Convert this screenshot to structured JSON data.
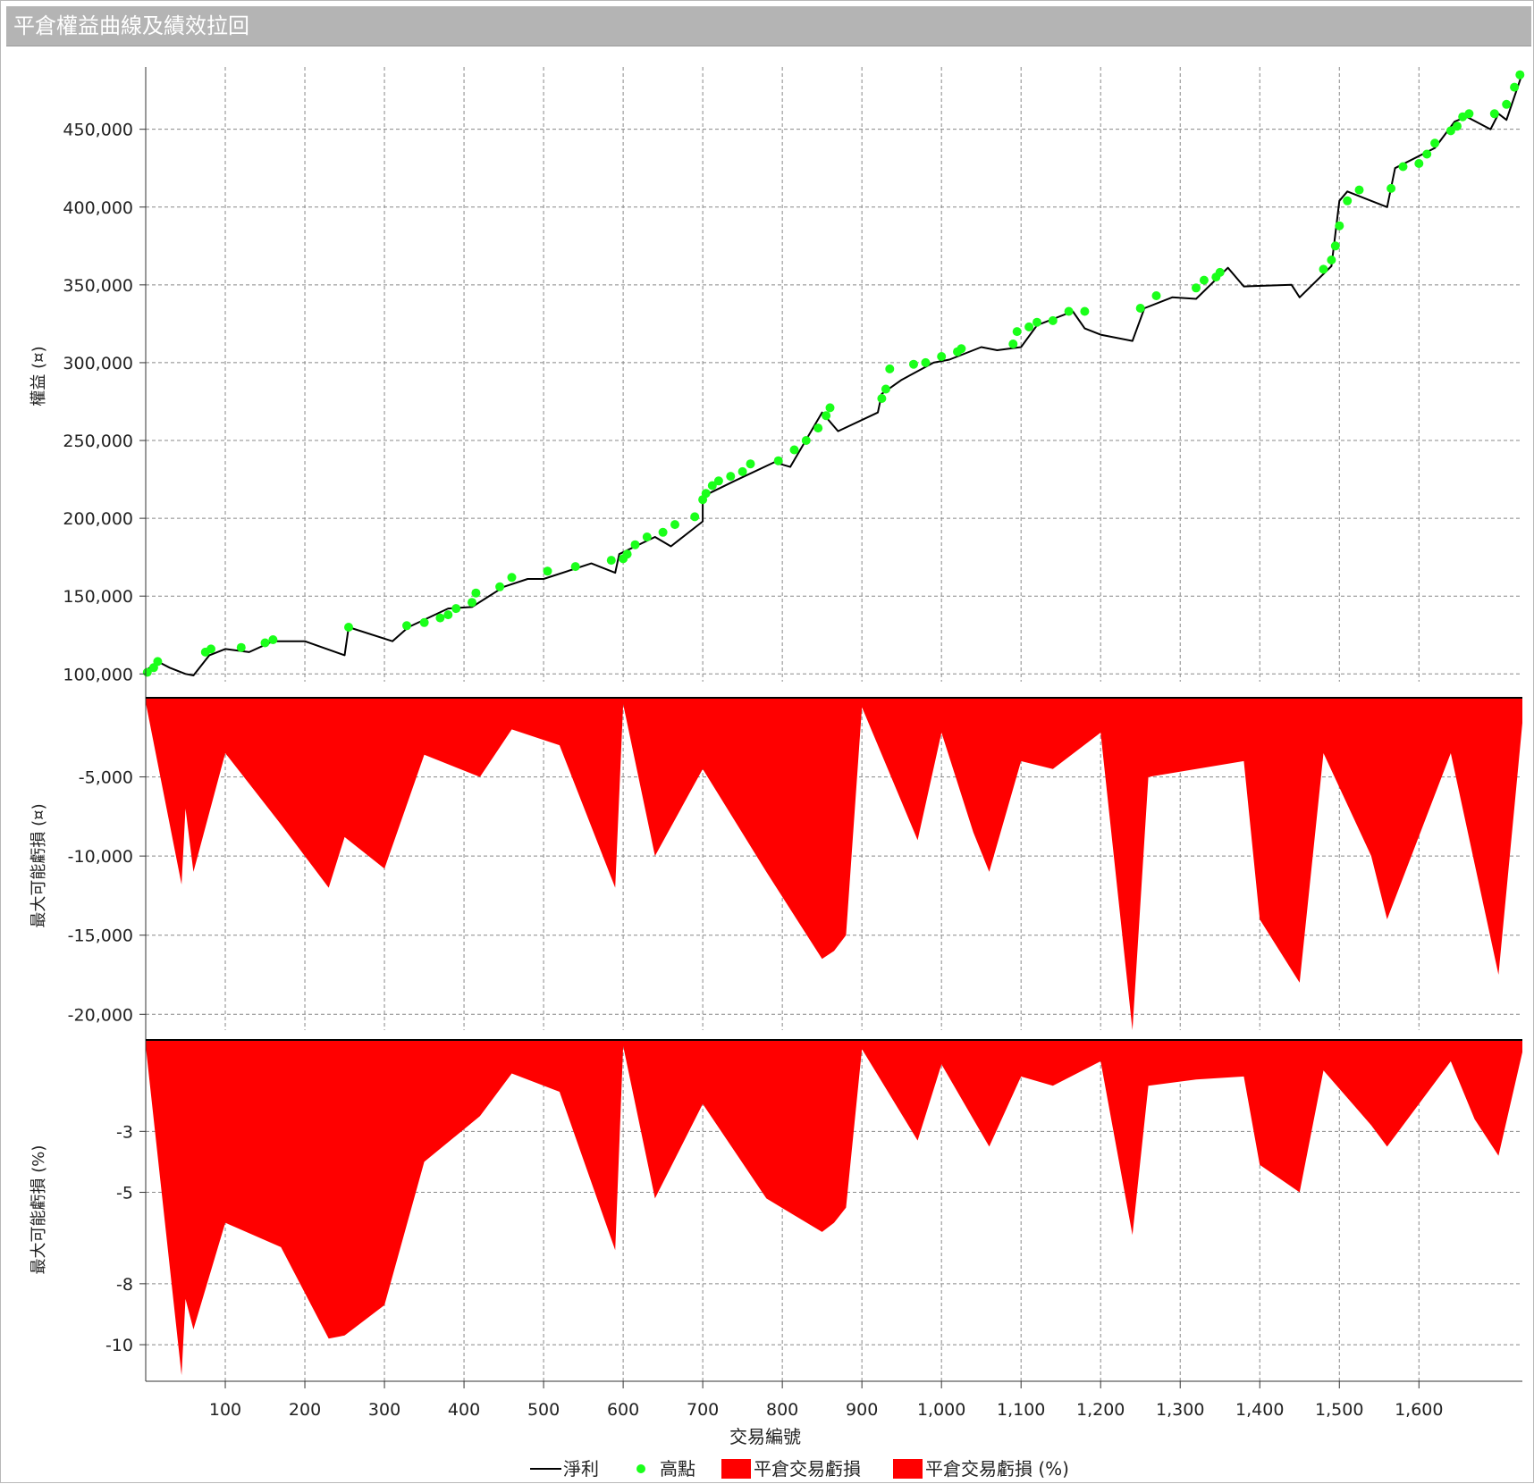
{
  "window": {
    "title": "平倉權益曲線及績效拉回"
  },
  "colors": {
    "line": "#000000",
    "high": "#1aff1a",
    "loss": "#ff0000",
    "grid": "#888888"
  },
  "legend": [
    {
      "label": "淨利",
      "kind": "line"
    },
    {
      "label": "高點",
      "kind": "dot"
    },
    {
      "label": "平倉交易虧損",
      "kind": "area"
    },
    {
      "label": "平倉交易虧損 (%)",
      "kind": "area"
    }
  ],
  "x_axis": {
    "label": "交易編號",
    "range": [
      0,
      1730
    ],
    "ticks": [
      100,
      200,
      300,
      400,
      500,
      600,
      700,
      800,
      900,
      1000,
      1100,
      1200,
      1300,
      1400,
      1500,
      1600
    ],
    "tick_labels": [
      "100",
      "200",
      "300",
      "400",
      "500",
      "600",
      "700",
      "800",
      "900",
      "1,000",
      "1,100",
      "1,200",
      "1,300",
      "1,400",
      "1,500",
      "1,600"
    ]
  },
  "chart_data": [
    {
      "type": "line",
      "ylabel": "權益 (¤)",
      "ylim": [
        95000,
        490000
      ],
      "yticks": [
        100000,
        150000,
        200000,
        250000,
        300000,
        350000,
        400000,
        450000
      ],
      "ytick_labels": [
        "100,000",
        "150,000",
        "200,000",
        "250,000",
        "300,000",
        "350,000",
        "400,000",
        "450,000"
      ],
      "grid": true,
      "series": [
        {
          "name": "淨利",
          "x": [
            0,
            15,
            30,
            50,
            60,
            80,
            100,
            130,
            160,
            200,
            250,
            255,
            310,
            330,
            380,
            410,
            450,
            480,
            500,
            560,
            590,
            595,
            640,
            660,
            700,
            700,
            740,
            790,
            810,
            850,
            870,
            920,
            925,
            950,
            990,
            1010,
            1050,
            1070,
            1100,
            1120,
            1165,
            1180,
            1200,
            1240,
            1255,
            1290,
            1320,
            1360,
            1380,
            1440,
            1450,
            1490,
            1500,
            1510,
            1560,
            1570,
            1620,
            1645,
            1660,
            1690,
            1700,
            1710,
            1730
          ],
          "y": [
            102000,
            108000,
            104000,
            100000,
            99000,
            112000,
            116000,
            114000,
            121000,
            121000,
            112000,
            130000,
            121000,
            130000,
            142000,
            143000,
            156000,
            161000,
            161000,
            171000,
            165000,
            177000,
            188000,
            182000,
            198000,
            214000,
            224000,
            236000,
            233000,
            268000,
            256000,
            268000,
            280000,
            289000,
            300000,
            302000,
            310000,
            308000,
            310000,
            324000,
            333000,
            322000,
            318000,
            314000,
            335000,
            342000,
            341000,
            361000,
            349000,
            350000,
            342000,
            362000,
            404000,
            410000,
            400000,
            425000,
            438000,
            455000,
            458000,
            450000,
            460000,
            456000,
            486000
          ]
        },
        {
          "name": "高點",
          "x": [
            2,
            10,
            15,
            75,
            82,
            120,
            150,
            160,
            255,
            328,
            350,
            370,
            380,
            390,
            410,
            415,
            445,
            460,
            505,
            540,
            585,
            600,
            605,
            615,
            630,
            650,
            665,
            690,
            700,
            704,
            712,
            720,
            735,
            750,
            760,
            795,
            815,
            830,
            845,
            855,
            860,
            925,
            930,
            935,
            965,
            980,
            1000,
            1020,
            1025,
            1090,
            1095,
            1110,
            1120,
            1140,
            1160,
            1180,
            1250,
            1270,
            1320,
            1330,
            1345,
            1350,
            1480,
            1490,
            1495,
            1500,
            1510,
            1525,
            1565,
            1580,
            1600,
            1610,
            1620,
            1640,
            1648,
            1655,
            1663,
            1695,
            1710,
            1720,
            1727
          ],
          "y": [
            101000,
            104000,
            108000,
            114000,
            116000,
            117000,
            120000,
            122000,
            130000,
            131000,
            133000,
            136000,
            138000,
            142000,
            146000,
            152000,
            156000,
            162000,
            166000,
            169000,
            173000,
            174000,
            177000,
            183000,
            188000,
            191000,
            196000,
            201000,
            212000,
            216000,
            221000,
            224000,
            227000,
            230000,
            235000,
            237000,
            244000,
            250000,
            258000,
            266000,
            271000,
            277000,
            283000,
            296000,
            299000,
            300000,
            304000,
            307000,
            309000,
            312000,
            320000,
            323000,
            326000,
            327000,
            333000,
            333000,
            335000,
            343000,
            348000,
            353000,
            355000,
            358000,
            360000,
            366000,
            375000,
            388000,
            404000,
            411000,
            412000,
            426000,
            428000,
            434000,
            441000,
            449000,
            452000,
            458000,
            460000,
            460000,
            466000,
            477000,
            485000
          ]
        }
      ]
    },
    {
      "type": "area",
      "ylabel": "最大可能虧損 (¤)",
      "ylim": [
        -21000,
        0
      ],
      "yticks": [
        -5000,
        -10000,
        -15000,
        -20000
      ],
      "ytick_labels": [
        "-5,000",
        "-10,000",
        "-15,000",
        "-20,000"
      ],
      "grid": true,
      "series": [
        {
          "name": "平倉交易虧損",
          "x": [
            0,
            45,
            50,
            60,
            100,
            170,
            230,
            250,
            300,
            350,
            420,
            460,
            520,
            590,
            600,
            640,
            700,
            780,
            850,
            865,
            880,
            900,
            970,
            1000,
            1040,
            1060,
            1100,
            1140,
            1200,
            1240,
            1260,
            1320,
            1380,
            1400,
            1450,
            1480,
            1540,
            1560,
            1640,
            1670,
            1700,
            1730
          ],
          "y": [
            -300,
            -11800,
            -7000,
            -11000,
            -3500,
            -8000,
            -12000,
            -8800,
            -10800,
            -3600,
            -5000,
            -2000,
            -3000,
            -12000,
            -400,
            -10000,
            -4500,
            -11000,
            -16500,
            -16000,
            -15000,
            -600,
            -9000,
            -2200,
            -8500,
            -11000,
            -4000,
            -4500,
            -2200,
            -21000,
            -5000,
            -4500,
            -4000,
            -14000,
            -18000,
            -3500,
            -10000,
            -14000,
            -3500,
            -10500,
            -17500,
            -1600
          ]
        }
      ]
    },
    {
      "type": "area",
      "ylabel": "最大可能虧損 (%)",
      "ylim": [
        -11.2,
        0
      ],
      "yticks": [
        -3,
        -5,
        -8,
        -10
      ],
      "ytick_labels": [
        "-3",
        "-5",
        "-8",
        "-10"
      ],
      "grid": true,
      "series": [
        {
          "name": "平倉交易虧損 (%)",
          "x": [
            0,
            45,
            50,
            60,
            100,
            170,
            230,
            250,
            300,
            350,
            420,
            460,
            520,
            590,
            600,
            640,
            700,
            780,
            850,
            865,
            880,
            900,
            970,
            1000,
            1040,
            1060,
            1100,
            1140,
            1200,
            1240,
            1260,
            1320,
            1380,
            1400,
            1450,
            1480,
            1540,
            1560,
            1640,
            1670,
            1700,
            1730
          ],
          "y": [
            -0.2,
            -11.0,
            -8.5,
            -9.5,
            -6.0,
            -6.8,
            -9.8,
            -9.7,
            -8.7,
            -4.0,
            -2.5,
            -1.1,
            -1.7,
            -6.9,
            -0.2,
            -5.2,
            -2.1,
            -5.2,
            -6.3,
            -6.0,
            -5.5,
            -0.3,
            -3.3,
            -0.8,
            -2.6,
            -3.5,
            -1.2,
            -1.5,
            -0.7,
            -6.4,
            -1.5,
            -1.3,
            -1.2,
            -4.1,
            -5.0,
            -1.0,
            -2.8,
            -3.5,
            -0.7,
            -2.6,
            -3.8,
            -0.4
          ]
        }
      ]
    }
  ]
}
